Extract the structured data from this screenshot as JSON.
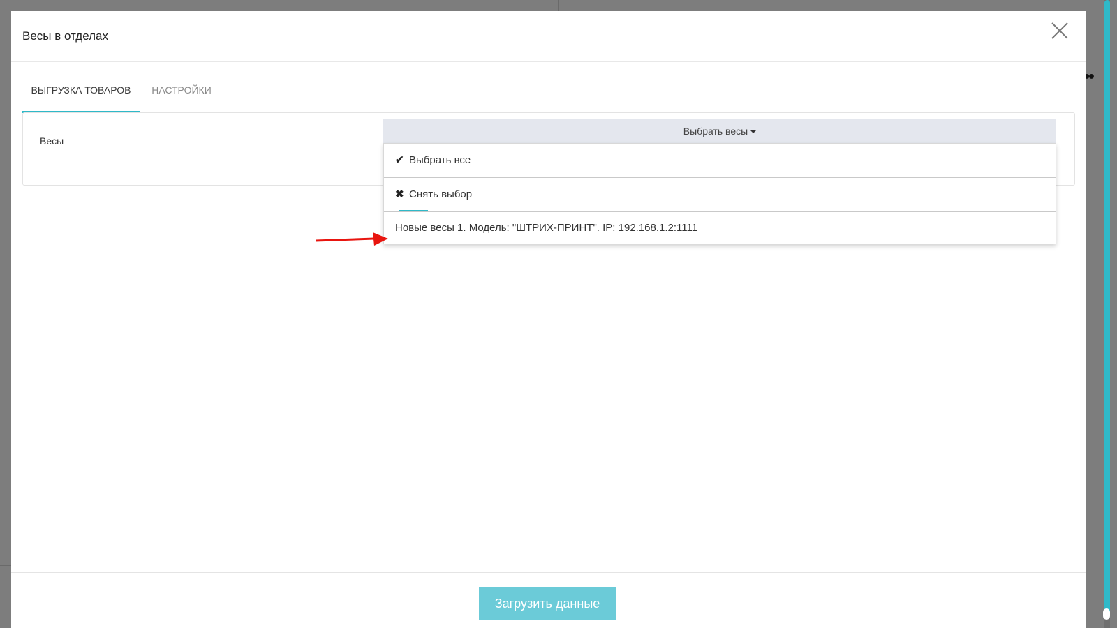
{
  "modal": {
    "title": "Весы в отделах",
    "close_label": "×"
  },
  "tabs": [
    {
      "label": "ВЫГРУЗКА ТОВАРОВ",
      "active": true
    },
    {
      "label": "НАСТРОЙКИ",
      "active": false
    }
  ],
  "form": {
    "scales_label": "Весы",
    "select_button_label": "Выбрать весы"
  },
  "dropdown": {
    "select_all_icon": "✔",
    "select_all_label": "Выбрать все",
    "deselect_icon": "✖",
    "deselect_label": "Снять выбор",
    "items": [
      {
        "label": "Новые весы 1. Модель: \"ШТРИХ-ПРИНТ\". IP: 192.168.1.2:1111"
      }
    ]
  },
  "footer": {
    "load_button_label": "Загрузить данные"
  },
  "colors": {
    "accent": "#2fb9c8",
    "button": "#6bcbd8",
    "annotation_arrow": "#e8150f",
    "overlay": "#7d7d7d"
  },
  "icons": {
    "close": "close-icon",
    "caret": "caret-down-icon",
    "check": "check-icon",
    "cross": "cross-icon",
    "annotation": "red-arrow-icon"
  }
}
